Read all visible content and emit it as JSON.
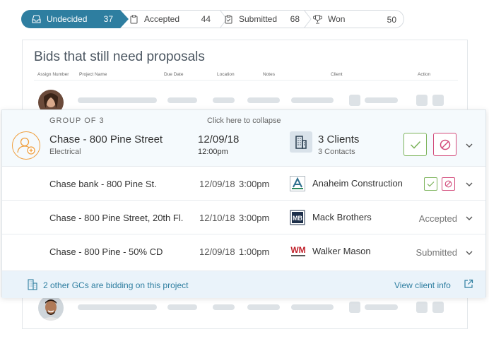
{
  "pipeline": [
    {
      "label": "Undecided",
      "count": "37",
      "icon": "inbox-icon"
    },
    {
      "label": "Accepted",
      "count": "44",
      "icon": "clipboard-icon"
    },
    {
      "label": "Submitted",
      "count": "68",
      "icon": "clipboard-check-icon"
    },
    {
      "label": "Won",
      "count": "50",
      "icon": "trophy-icon"
    }
  ],
  "card": {
    "title": "Bids that still need proposals",
    "columns": [
      "Assign Number",
      "Project Name",
      "Due Date",
      "Location",
      "Notes",
      "Client",
      "Action"
    ]
  },
  "group": {
    "label": "GROUP OF 3",
    "collapse": "Click here to collapse",
    "title": "Chase - 800 Pine Street",
    "trade": "Electrical",
    "date": "12/09/18",
    "time": "12:00pm",
    "clients": "3 Clients",
    "contacts": "3 Contacts",
    "rows": [
      {
        "name": "Chase bank - 800 Pine St.",
        "date": "12/09/18",
        "time": "3:00pm",
        "client": "Anaheim Construction",
        "status": "",
        "logo": "anaheim-logo"
      },
      {
        "name": "Chase - 800 Pine Street, 20th Fl.",
        "date": "12/10/18",
        "time": "3:00pm",
        "client": "Mack Brothers",
        "status": "Accepted",
        "logo": "mb-logo"
      },
      {
        "name": "Chase - 800 Pine - 50% CD",
        "date": "12/09/18",
        "time": "1:00pm",
        "client": "Walker Mason",
        "status": "Submitted",
        "logo": "wm-logo"
      }
    ],
    "footer": {
      "text": "2 other GCs are bidding on this project",
      "link": "View client info"
    }
  },
  "colors": {
    "accent": "#2e7ea0",
    "accept": "#7bb35a",
    "decline": "#d24a7a",
    "orange": "#f0a040"
  }
}
